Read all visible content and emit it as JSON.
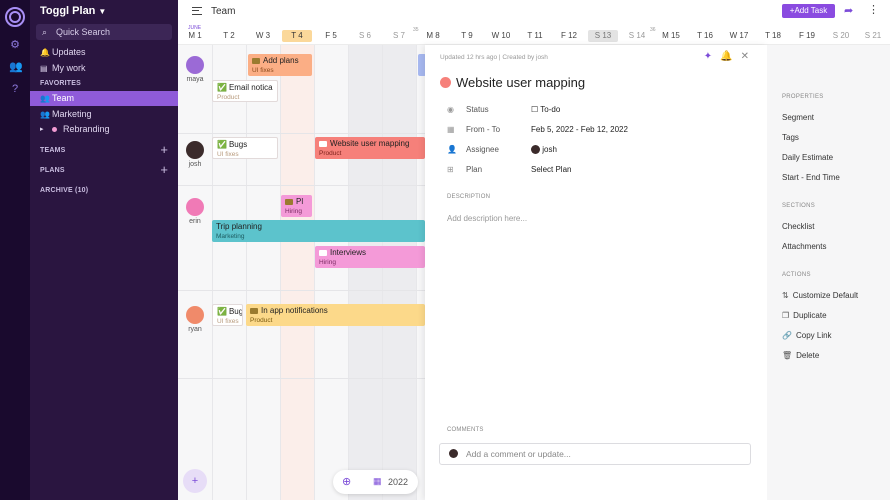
{
  "workspace": {
    "name": "Toggl Plan"
  },
  "sidebar": {
    "search_label": "Quick Search",
    "items": [
      {
        "label": "Updates",
        "icon": "bell-icon"
      },
      {
        "label": "My work",
        "icon": "list-icon"
      }
    ],
    "favorites_heading": "FAVORITES",
    "favorites": [
      {
        "label": "Team",
        "icon": "team-icon",
        "active": true
      },
      {
        "label": "Marketing",
        "icon": "team-icon"
      },
      {
        "label": "Rebranding",
        "icon": "dot-icon"
      }
    ],
    "teams_heading": "TEAMS",
    "plans_heading": "PLANS",
    "archive_heading": "ARCHIVE (10)"
  },
  "topbar": {
    "title": "Team",
    "add_task_label": "+Add Task"
  },
  "timeline": {
    "month_label": "JUNE",
    "days": [
      {
        "label": "M 1"
      },
      {
        "label": "T 2"
      },
      {
        "label": "W 3"
      },
      {
        "label": "T 4",
        "today": true
      },
      {
        "label": "F 5"
      },
      {
        "label": "S 6",
        "weekend": true
      },
      {
        "label": "S 7",
        "weekend": true
      },
      {
        "label": "M 8"
      },
      {
        "label": "T 9"
      },
      {
        "label": "W 10"
      },
      {
        "label": "T 11"
      },
      {
        "label": "F 12"
      },
      {
        "label": "S 13",
        "selected": true
      },
      {
        "label": "S 14",
        "weekend": true
      },
      {
        "label": "M 15"
      },
      {
        "label": "T 16"
      },
      {
        "label": "W 17"
      },
      {
        "label": "T 18"
      },
      {
        "label": "F 19"
      },
      {
        "label": "S 20",
        "weekend": true
      },
      {
        "label": "S 21",
        "weekend": true
      }
    ],
    "week_numbers": [
      "35",
      "36"
    ],
    "users": [
      {
        "name": "maya",
        "avatar_color": "#9b6ad6"
      },
      {
        "name": "josh",
        "avatar_color": "#3b2b2b"
      },
      {
        "name": "erin",
        "avatar_color": "#f07ab6"
      },
      {
        "name": "ryan",
        "avatar_color": "#f08a6a"
      }
    ],
    "tasks": [
      {
        "title": "Add plans",
        "plan": "UI fixes",
        "color": "orange",
        "icon": "bar"
      },
      {
        "title": "Email notica",
        "plan": "Product",
        "color": "white",
        "icon": "check"
      },
      {
        "title": "Bugs",
        "plan": "UI fixes",
        "color": "white",
        "icon": "check"
      },
      {
        "title": "Website user mapping",
        "plan": "Product",
        "color": "red",
        "icon": "card"
      },
      {
        "title": "Pl",
        "plan": "Hiring",
        "color": "pink",
        "icon": "bar"
      },
      {
        "title": "Trip planning",
        "plan": "Marketing",
        "color": "teal",
        "icon": ""
      },
      {
        "title": "Interviews",
        "plan": "Hiring",
        "color": "pink",
        "icon": "card"
      },
      {
        "title": "Bug",
        "plan": "UI fixes",
        "color": "white",
        "icon": "check"
      },
      {
        "title": "In app notifications",
        "plan": "Product",
        "color": "yellow",
        "icon": "bar"
      }
    ],
    "year_label": "2022"
  },
  "task_detail": {
    "meta": "Updated 12 hrs ago | Created by josh",
    "title": "Website user mapping",
    "title_color": "#f6807a",
    "fields": {
      "status_label": "Status",
      "status_value": "To-do",
      "dates_label": "From - To",
      "dates_value": "Feb 5, 2022 - Feb 12, 2022",
      "assignee_label": "Assignee",
      "assignee_value": "josh",
      "plan_label": "Plan",
      "plan_value": "Select Plan"
    },
    "description_heading": "DESCRIPTION",
    "description_placeholder": "Add description here...",
    "comments_heading": "COMMENTS",
    "comment_placeholder": "Add a comment or update..."
  },
  "properties": {
    "heading": "PROPERTIES",
    "items": [
      "Segment",
      "Tags",
      "Daily Estimate",
      "Start - End Time"
    ],
    "sections_heading": "SECTIONS",
    "sections": [
      "Checklist",
      "Attachments"
    ],
    "actions_heading": "ACTIONS",
    "actions": [
      {
        "label": "Customize Default",
        "icon": "sliders-icon"
      },
      {
        "label": "Duplicate",
        "icon": "copy-icon"
      },
      {
        "label": "Copy Link",
        "icon": "link-icon"
      },
      {
        "label": "Delete",
        "icon": "trash-icon"
      }
    ]
  }
}
